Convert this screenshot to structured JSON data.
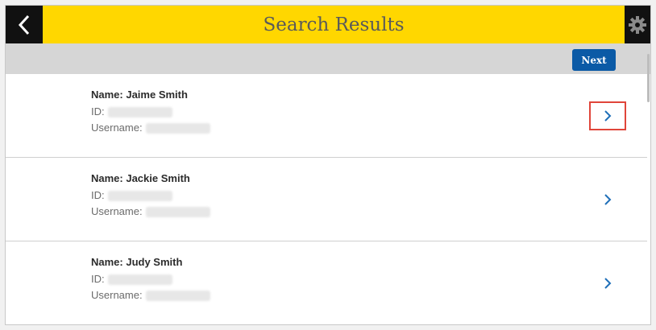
{
  "header": {
    "title": "Search Results",
    "back_icon": "chevron-left-icon",
    "settings_icon": "gear-icon"
  },
  "toolbar": {
    "next_label": "Next"
  },
  "results": [
    {
      "name": "Name: Jaime Smith",
      "id_label": "ID:",
      "username_label": "Username:"
    },
    {
      "name": "Name: Jackie Smith",
      "id_label": "ID:",
      "username_label": "Username:"
    },
    {
      "name": "Name: Judy Smith",
      "id_label": "ID:",
      "username_label": "Username:"
    }
  ],
  "colors": {
    "header_bg": "#ffd700",
    "button_bg": "#0b5aa6",
    "chevron": "#1f6fb8",
    "highlight": "#e0453a"
  }
}
